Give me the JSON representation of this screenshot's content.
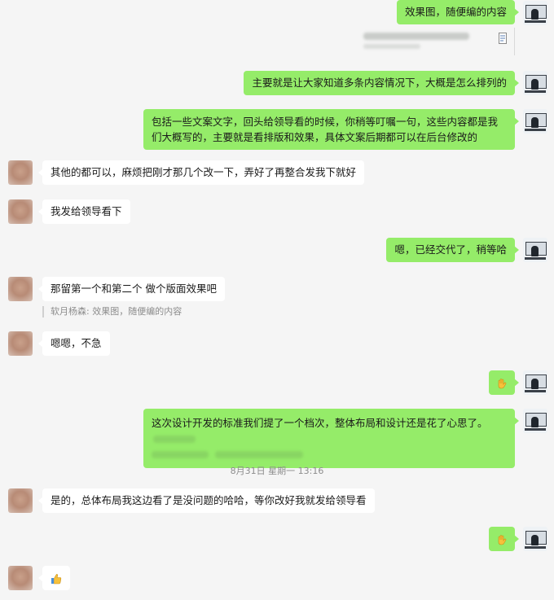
{
  "messages": {
    "m1": "效果图，随便编的内容",
    "m2": "主要就是让大家知道多条内容情况下，大概是怎么排列的",
    "m3": "包括一些文案文字，回头给领导看的时候，你稍等叮嘱一句，这些内容都是我们大概写的，主要就是看排版和效果，具体文案后期都可以在后台修改的",
    "m4": "其他的都可以，麻烦把刚才那几个改一下，弄好了再整合发我下就好",
    "m5": "我发给领导看下",
    "m6": "嗯，已经交代了，稍等哈",
    "m7": "那留第一个和第二个 做个版面效果吧",
    "m7_quote": "软月杨森: 效果图，随便编的内容",
    "m8": "嗯嗯，不急",
    "m10": "这次设计开发的标准我们提了一个档次，整体布局和设计还是花了心思了。",
    "timestamp": "8月31日 星期一 13:16",
    "m11": "是的，总体布局我这边看了是没问题的哈哈，等你改好我就发给领导看"
  },
  "icons": {
    "m9": "waving-hand-emoji",
    "m12": "waving-hand-emoji",
    "m13": "thumbs-up-emoji"
  },
  "colors": {
    "me_bubble": "#95ec69",
    "other_bubble": "#ffffff",
    "background": "#f5f5f5"
  }
}
